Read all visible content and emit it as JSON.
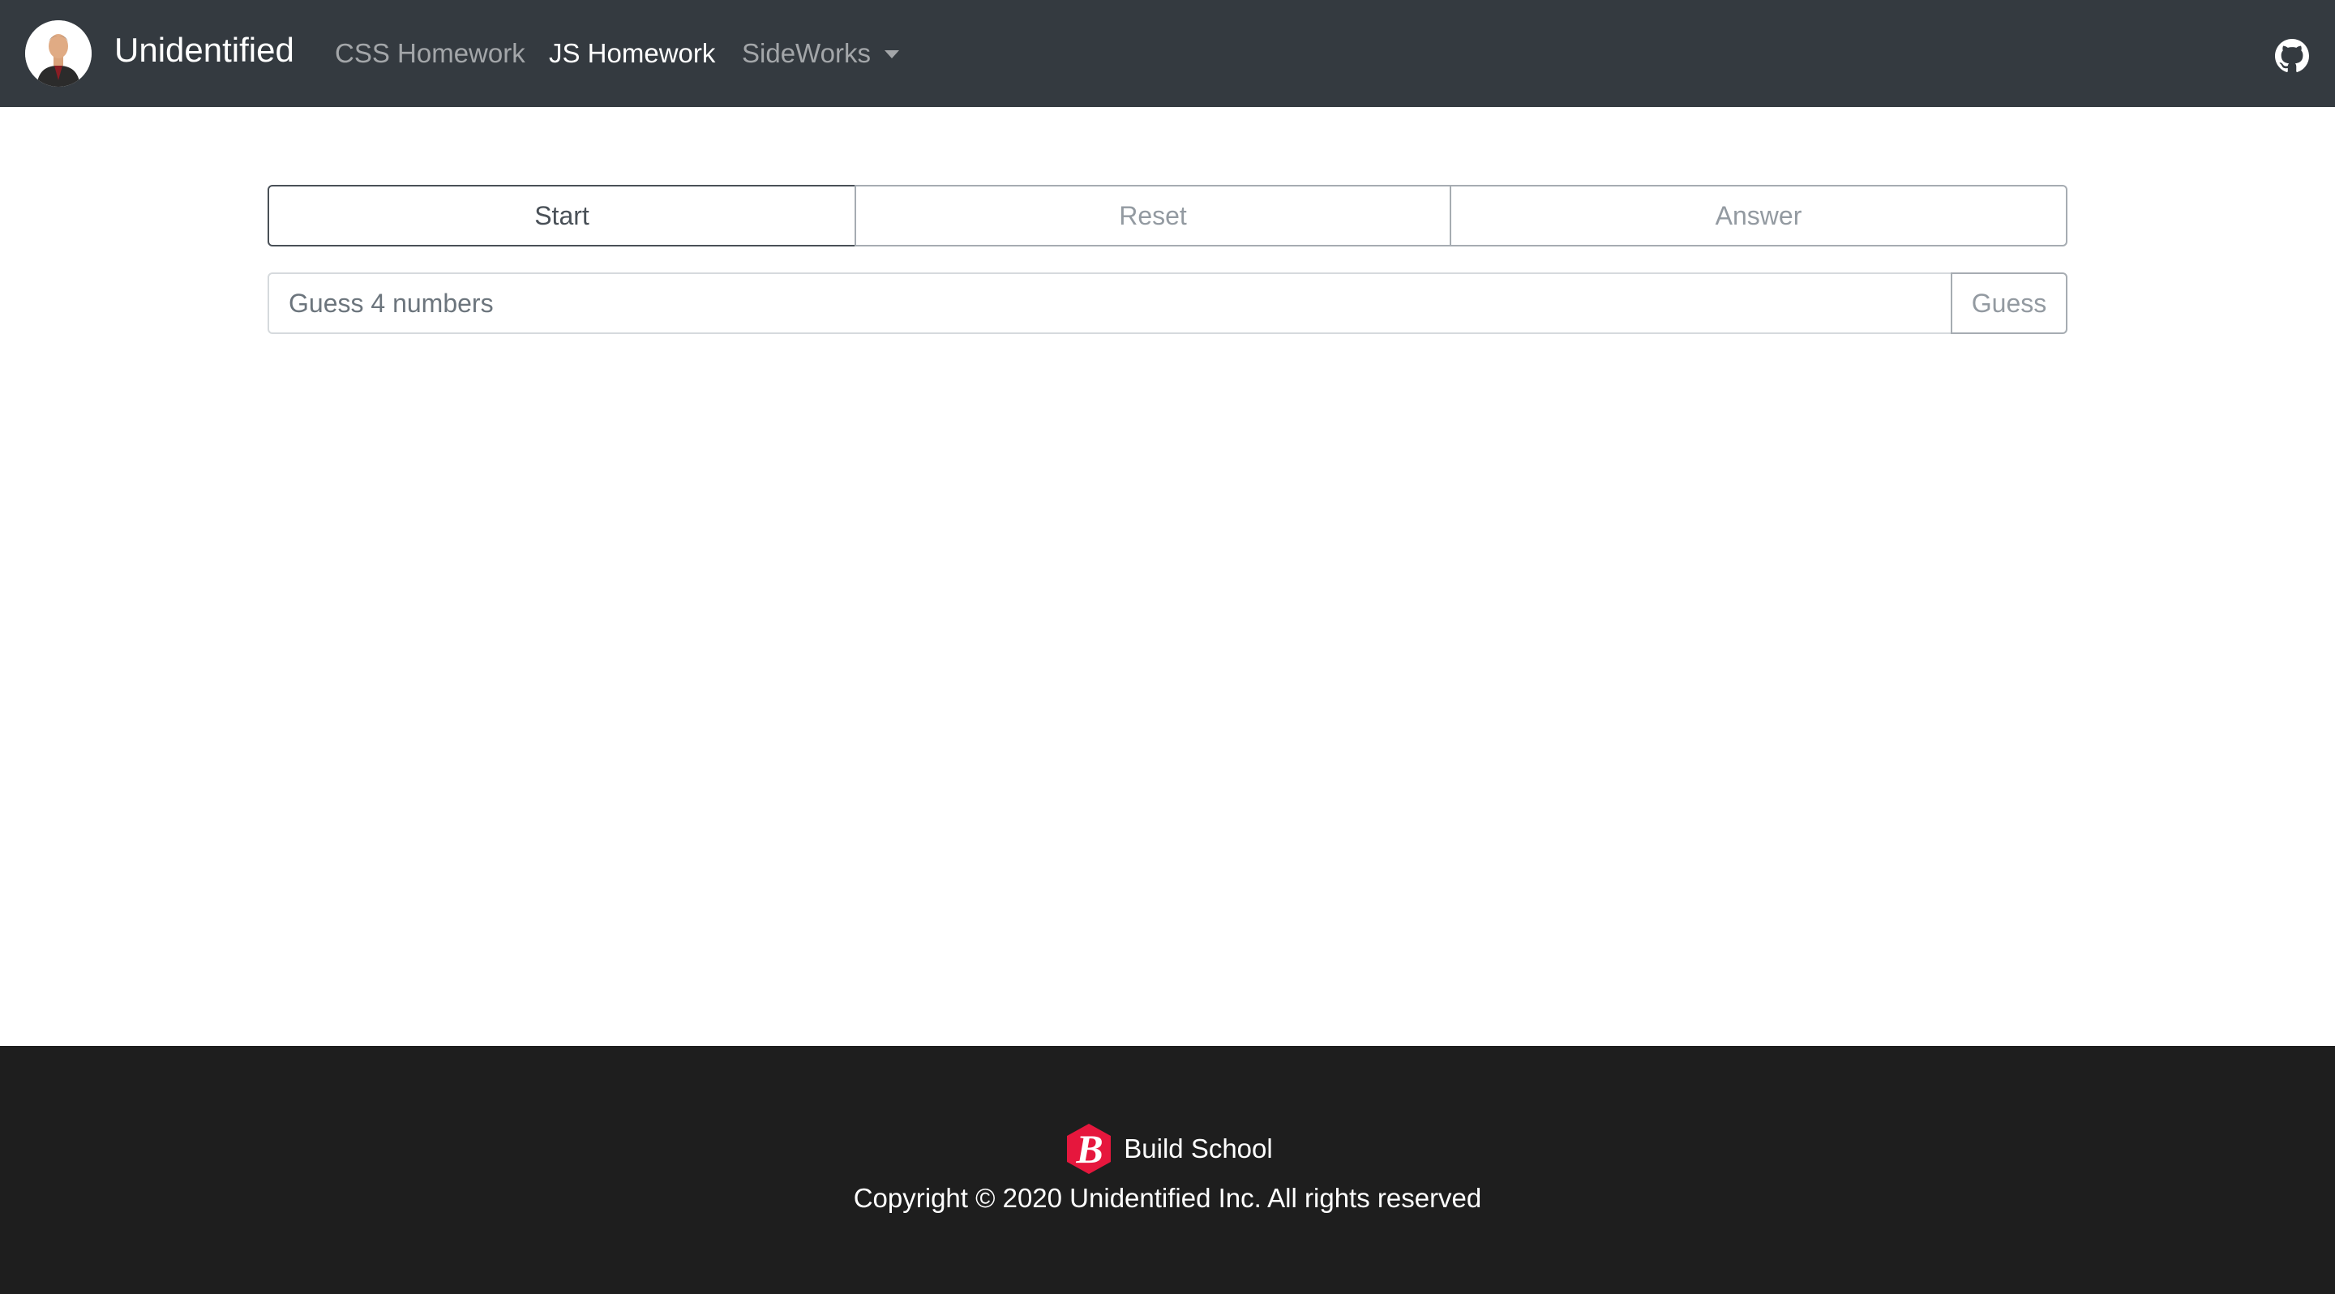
{
  "navbar": {
    "brand": "Unidentified",
    "links": [
      {
        "label": "CSS Homework",
        "active": false
      },
      {
        "label": "JS Homework",
        "active": true
      },
      {
        "label": "SideWorks",
        "active": false,
        "dropdown": true
      }
    ],
    "avatar_icon": "user-avatar",
    "github_icon": "github-icon",
    "colors": {
      "background": "#343a40",
      "active_text": "#ffffff",
      "inactive_text": "rgba(255,255,255,0.55)"
    }
  },
  "game": {
    "buttons": {
      "start": "Start",
      "reset": "Reset",
      "answer": "Answer"
    },
    "guess_input": {
      "placeholder": "Guess 4 numbers",
      "value": ""
    },
    "guess_button": "Guess"
  },
  "footer": {
    "logo_icon": "build-school-logo",
    "brand": "Build School",
    "copyright": "Copyright © 2020 Unidentified Inc. All rights reserved",
    "colors": {
      "background": "#1e1e1e",
      "logo": "#e6173d"
    }
  }
}
